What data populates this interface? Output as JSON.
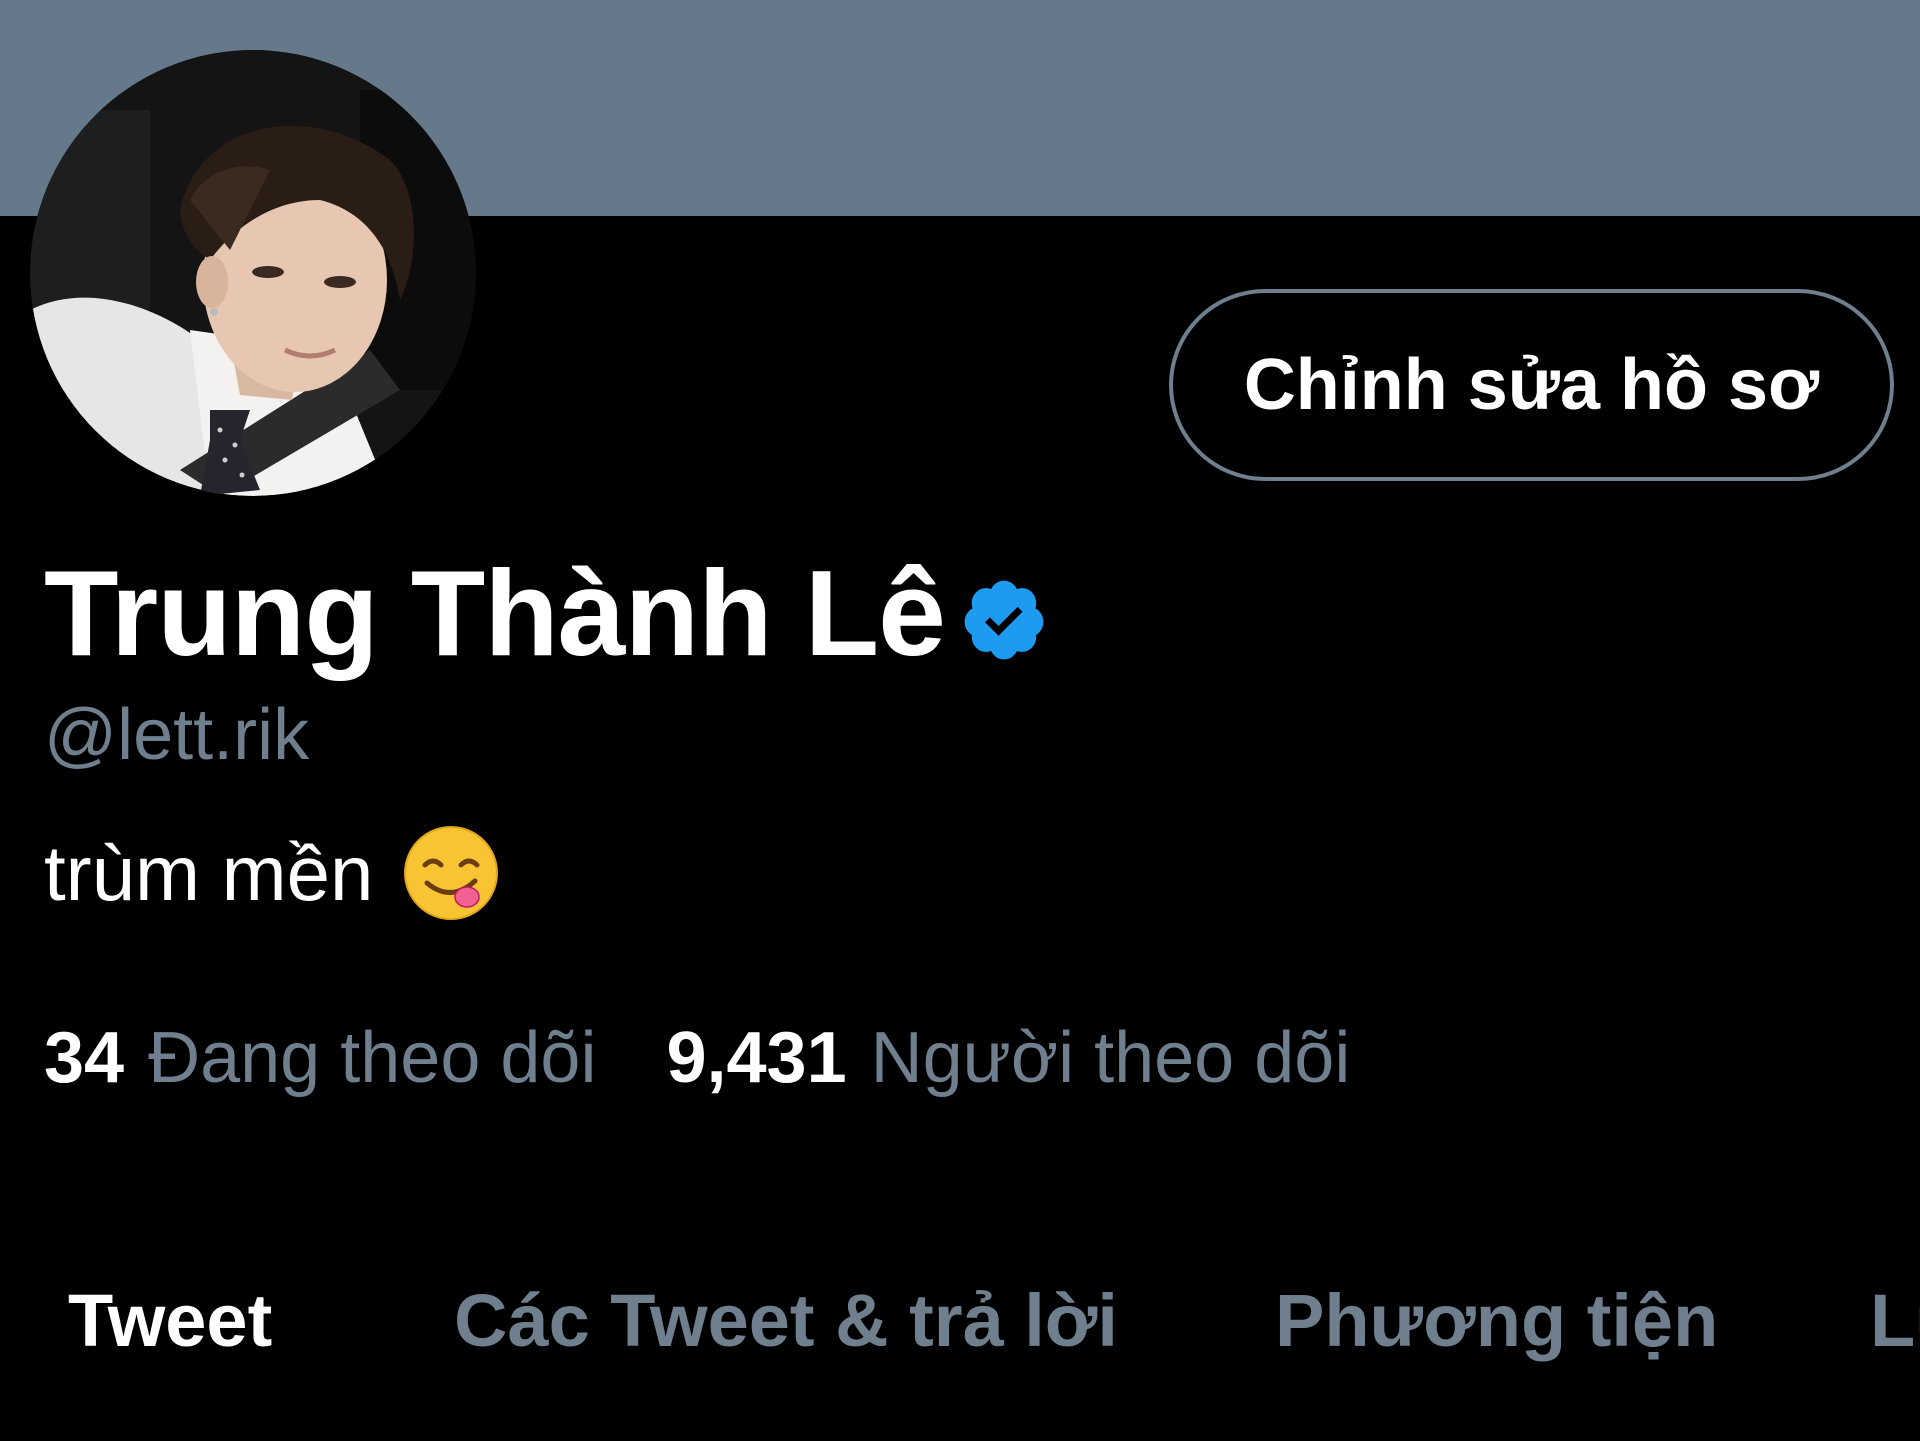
{
  "profile": {
    "banner_color": "#66798b",
    "avatar_icon": "profile-photo",
    "edit_button_label": "Chỉnh sửa hồ sơ",
    "display_name": "Trung Thành Lê",
    "verified_icon": "verified-badge-icon",
    "handle": "@lett.rik",
    "bio_text": "trùm mền",
    "bio_emoji": "😋"
  },
  "stats": {
    "following_count": "34",
    "following_label": "Đang theo dõi",
    "followers_count": "9,431",
    "followers_label": "Người theo dõi"
  },
  "tabs": [
    {
      "label": "Tweet",
      "active": true
    },
    {
      "label": "Các Tweet & trả lời",
      "active": false
    },
    {
      "label": "Phương tiện",
      "active": false
    },
    {
      "label": "Lượt thích",
      "active": false
    }
  ],
  "colors": {
    "background": "#000000",
    "secondary_text": "#6f7f8e",
    "verified_blue": "#1d9bf0",
    "primary_text": "#ffffff"
  }
}
